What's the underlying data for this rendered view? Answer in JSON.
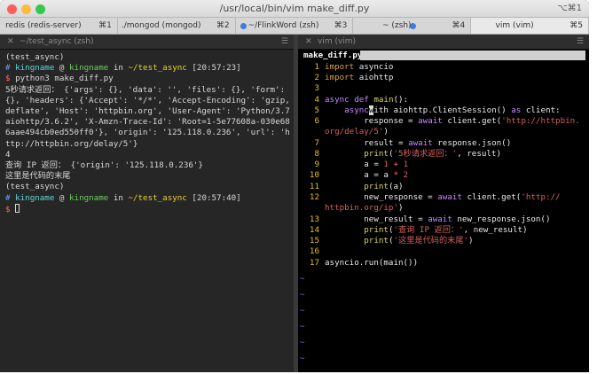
{
  "window": {
    "title": "/usr/local/bin/vim make_diff.py",
    "shortcut": "⌥⌘1",
    "traffic_lights": {
      "close": "#fc605b",
      "minimize": "#fdbc40",
      "maximize": "#34c84a"
    }
  },
  "tabs": [
    {
      "label": "redis (redis-server)",
      "key": "⌘1",
      "dot": false,
      "active": false
    },
    {
      "label": "./mongod (mongod)",
      "key": "⌘2",
      "dot": false,
      "active": false
    },
    {
      "label": "~/FlinkWord (zsh)",
      "key": "⌘3",
      "dot": true,
      "active": false
    },
    {
      "label": "~ (zsh)",
      "key": "⌘4",
      "dot": true,
      "active": false
    },
    {
      "label": "vim (vim)",
      "key": "⌘5",
      "dot": false,
      "active": true
    }
  ],
  "left_pane": {
    "close_glyph": "✕",
    "title": "~/test_async (zsh)",
    "menu_glyph": "☰",
    "env1": "(test_async)",
    "prompt_user": "kingname",
    "prompt_at": "@",
    "prompt_host": "kingname",
    "prompt_in": "in",
    "prompt_dir": "~/test_async",
    "prompt_time1": "[20:57:23]",
    "prompt_sign": "$",
    "command": "python3 make_diff.py",
    "output_long": "5秒请求返回： {'args': {}, 'data': '', 'files': {}, 'form': {}, 'headers': {'Accept': '*/*', 'Accept-Encoding': 'gzip, deflate', 'Host': 'httpbin.org', 'User-Agent': 'Python/3.7 aiohttp/3.6.2', 'X-Amzn-Trace-Id': 'Root=1-5e77608a-030e686aae494cb0ed550ff0'}, 'origin': '125.118.0.236', 'url': 'http://httpbin.org/delay/5'}",
    "output_4": "4",
    "output_ip": "查询 IP 返回： {'origin': '125.118.0.236'}",
    "output_end": "这里是代码的末尾",
    "env2": "(test_async)",
    "prompt_time2": "[20:57:40]"
  },
  "right_pane": {
    "close_glyph": "✕",
    "title": "vim (vim)",
    "menu_glyph": "☰",
    "filename": "make_diff.py",
    "code": {
      "l1_kw": "import",
      "l1_rest": " asyncio",
      "l2_kw": "import",
      "l2_rest": " aiohttp",
      "l4_kw": "async def",
      "l4_fn": "main",
      "l4_rest": "():",
      "l5_kw": "async",
      "l5_cursor": "w",
      "l5_rest": "ith aiohttp.ClientSession() ",
      "l5_as": "as",
      "l5_end": " client:",
      "l6_a": "response = ",
      "l6_aw": "await",
      "l6_b": " client.get(",
      "l6_str1": "'http://httpbin.",
      "l6_str2": "org/delay/5'",
      "l6_end": ")",
      "l7_a": "result = ",
      "l7_aw": "await",
      "l7_b": " response.json()",
      "l8_fn": "print",
      "l8_a": "(",
      "l8_str": "'5秒请求返回：'",
      "l8_b": ", result)",
      "l9_a": "a = ",
      "l9_n1": "1",
      "l9_op": " + ",
      "l9_n2": "1",
      "l10_a": "a = a ",
      "l10_op": "*",
      "l10_n": " 2",
      "l11_fn": "print",
      "l11_a": "(a)",
      "l12_a": "new_response = ",
      "l12_aw": "await",
      "l12_b": " client.get(",
      "l12_str1": "'http://",
      "l12_str2": "httpbin.org/ip'",
      "l12_end": ")",
      "l13_a": "new_result = ",
      "l13_aw": "await",
      "l13_b": " new_response.json()",
      "l14_fn": "print",
      "l14_a": "(",
      "l14_str": "'查询 IP 返回：'",
      "l14_b": ", new_result)",
      "l15_fn": "print",
      "l15_a": "(",
      "l15_str": "'这里是代码的末尾'",
      "l15_b": ")",
      "l17": "asyncio.run(main())"
    },
    "line_numbers": [
      "1",
      "2",
      "3",
      "4",
      "5",
      "6",
      "7",
      "8",
      "9",
      "10",
      "11",
      "12",
      "13",
      "14",
      "15",
      "16",
      "17"
    ],
    "tilde": "~"
  }
}
